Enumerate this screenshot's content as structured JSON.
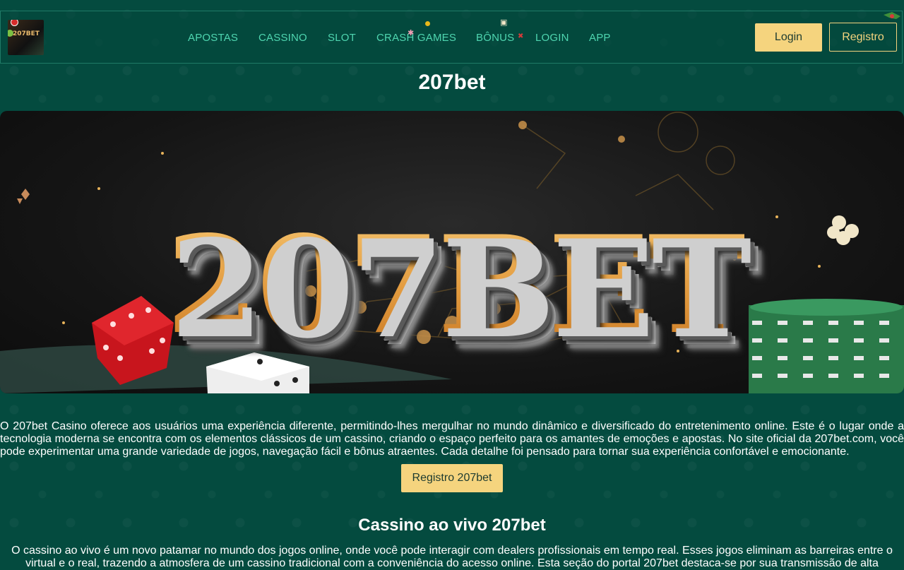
{
  "header": {
    "logo_alt": "207BET",
    "nav": [
      {
        "label": "APOSTAS"
      },
      {
        "label": "CASSINO"
      },
      {
        "label": "SLOT"
      },
      {
        "label": "CRASH GAMES"
      },
      {
        "label": "BÔNUS"
      },
      {
        "label": "LOGIN"
      },
      {
        "label": "APP"
      }
    ],
    "login_label": "Login",
    "register_label": "Registro"
  },
  "page": {
    "title": "207bet",
    "banner_text": "207BET",
    "intro": "O 207bet Casino oferece aos usuários uma experiência diferente, permitindo-lhes mergulhar no mundo dinâmico e diversificado do entretenimento online. Este é o lugar onde a tecnologia moderna se encontra com os elementos clássicos de um cassino, criando o espaço perfeito para os amantes de emoções e apostas. No site oficial da 207bet.com, você pode experimentar uma grande variedade de jogos, navegação fácil e bônus atraentes. Cada detalhe foi pensado para tornar sua experiência confortável e emocionante.",
    "cta_label": "Registro 207bet",
    "section_title": "Cassino ao vivo 207bet",
    "section_text": "O cassino ao vivo é um novo patamar no mundo dos jogos online, onde você pode interagir com dealers profissionais em tempo real. Esses jogos eliminam as barreiras entre o virtual e o real, trazendo a atmosfera de um cassino tradicional com a conveniência do acesso online. Esta seção do portal 207bet destaca-se por sua transmissão de alta"
  },
  "colors": {
    "background": "#044b3f",
    "nav_text": "#4fd6b0",
    "accent": "#f5d47e"
  }
}
